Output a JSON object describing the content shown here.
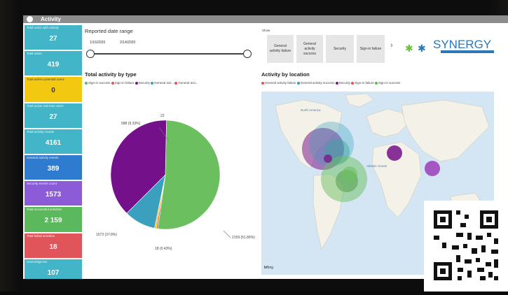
{
  "window": {
    "title": "Activity"
  },
  "sidebar": {
    "kpis": [
      {
        "label": "Total users with activity",
        "value": "27",
        "color": "#43b5c8"
      },
      {
        "label": "Total users",
        "value": "419",
        "color": "#43b5c8"
      },
      {
        "label": "Total admin-potential users",
        "value": "0",
        "color": "#f2c811"
      },
      {
        "label": "Total active risk-less users",
        "value": "27",
        "color": "#43b5c8"
      },
      {
        "label": "Total activity counts",
        "value": "4161",
        "color": "#43b5c8"
      },
      {
        "label": "General activity events",
        "value": "389",
        "color": "#2e7bcf"
      },
      {
        "label": "Security events count",
        "value": "1573",
        "color": "#8b5bd8"
      },
      {
        "label": "Total successful activities",
        "value": "2 159",
        "color": "#5cb85c"
      },
      {
        "label": "Total failed activities",
        "value": "18",
        "color": "#e0555a"
      },
      {
        "label": "Users/Sign-ins",
        "value": "107",
        "color": "#43b5c8"
      }
    ]
  },
  "date_range": {
    "title": "Reported date range",
    "start": "1/16/2020",
    "end": "2/14/2020"
  },
  "show_filter": {
    "label": "Show",
    "buttons": [
      "General activity failure",
      "General activity success",
      "Security",
      "Sign-in failure"
    ]
  },
  "brand": {
    "name": "SYNERGY"
  },
  "pie": {
    "title": "Total activity by type",
    "legend": [
      {
        "label": "Sign-in success",
        "color": "#5cb85c"
      },
      {
        "label": "Sign-in failure",
        "color": "#e0555a"
      },
      {
        "label": "Security",
        "color": "#7a1a8a"
      },
      {
        "label": "General acti...",
        "color": "#3aa39e"
      },
      {
        "label": "General acti...",
        "color": "#e0555a"
      }
    ],
    "labels": {
      "top_small": "22",
      "top_left": "588 (9.33%)",
      "bottom_left": "1573 (37.8%)",
      "bottom_mid": "18 (0.43%)",
      "bottom_right": "2159 (51.89%)"
    }
  },
  "map": {
    "title": "Activity by location",
    "legend": [
      {
        "label": "General activity failure",
        "color": "#e0555a"
      },
      {
        "label": "General activity success",
        "color": "#3aa39e"
      },
      {
        "label": "Security",
        "color": "#7a1a8a"
      },
      {
        "label": "Sign-in failure",
        "color": "#e0555a"
      },
      {
        "label": "Sign-in success",
        "color": "#5cb85c"
      }
    ],
    "place_labels": {
      "north_america": "North America",
      "atlantic": "Atlantic Ocean"
    },
    "attribution": "Bing"
  },
  "chart_data": {
    "type": "pie",
    "title": "Total activity by type",
    "categories": [
      "Sign-in success",
      "Security",
      "General activity success",
      "Sign-in failure",
      "General activity failure"
    ],
    "values": [
      2159,
      1573,
      388,
      18,
      22
    ],
    "colors": [
      "#6cbf5f",
      "#74108a",
      "#3aa0bd",
      "#e0555a",
      "#f2c811"
    ]
  }
}
